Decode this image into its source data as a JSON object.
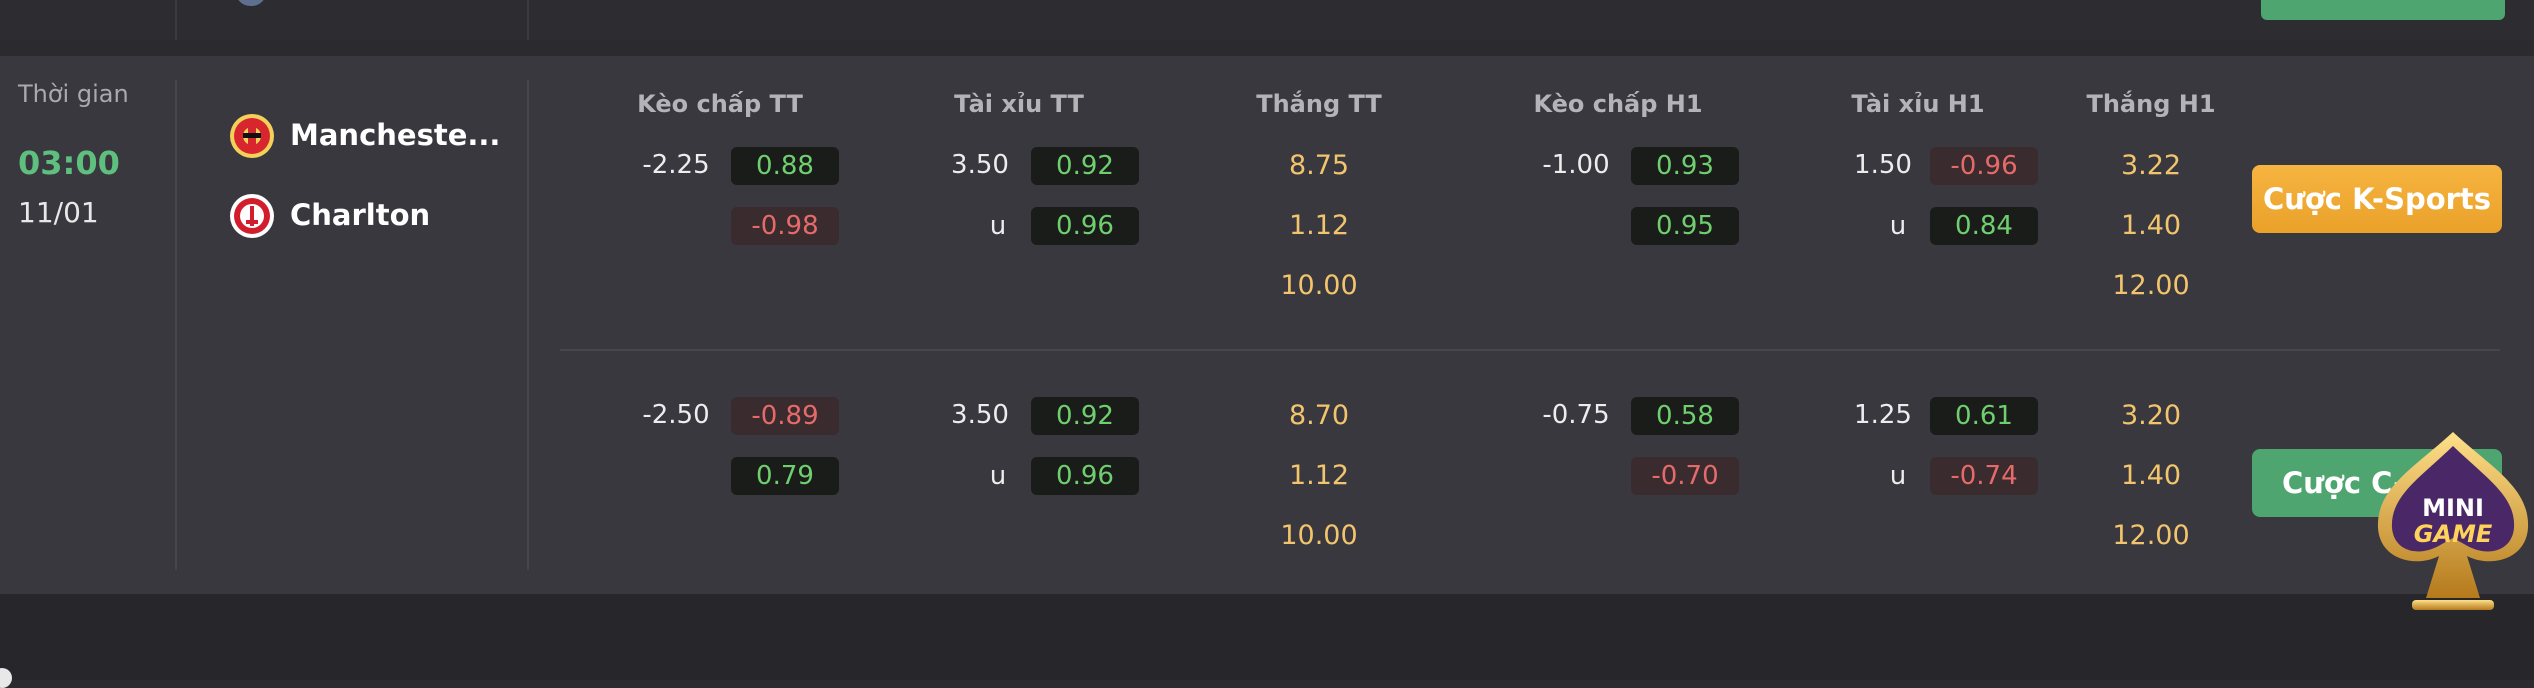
{
  "card": {
    "time_label": "Thời gian",
    "time": "03:00",
    "date": "11/01",
    "home_team": "Mancheste...",
    "away_team": "Charlton"
  },
  "headers": [
    "Kèo chấp TT",
    "Tài xỉu TT",
    "Thắng TT",
    "Kèo chấp H1",
    "Tài xỉu H1",
    "Thắng H1"
  ],
  "market1": {
    "hdp_tt_line": "-2.25",
    "hdp_tt_home": "0.88",
    "hdp_tt_away": "-0.98",
    "ou_tt_line": "3.50",
    "ou_tt_over": "0.92",
    "ou_tt_u": "u",
    "ou_tt_under": "0.96",
    "win_tt_home": "8.75",
    "win_tt_away": "1.12",
    "win_tt_draw": "10.00",
    "hdp_h1_line": "-1.00",
    "hdp_h1_home": "0.93",
    "hdp_h1_away": "0.95",
    "ou_h1_line": "1.50",
    "ou_h1_over": "-0.96",
    "ou_h1_u": "u",
    "ou_h1_under": "0.84",
    "win_h1_home": "3.22",
    "win_h1_away": "1.40",
    "win_h1_draw": "12.00",
    "button": "Cược K-Sports"
  },
  "market2": {
    "hdp_tt_line": "-2.50",
    "hdp_tt_home": "-0.89",
    "hdp_tt_away": "0.79",
    "ou_tt_line": "3.50",
    "ou_tt_over": "0.92",
    "ou_tt_u": "u",
    "ou_tt_under": "0.96",
    "win_tt_home": "8.70",
    "win_tt_away": "1.12",
    "win_tt_draw": "10.00",
    "hdp_h1_line": "-0.75",
    "hdp_h1_home": "0.58",
    "hdp_h1_away": "-0.70",
    "ou_h1_line": "1.25",
    "ou_h1_over": "0.61",
    "ou_h1_u": "u",
    "ou_h1_under": "-0.74",
    "win_h1_home": "3.20",
    "win_h1_away": "1.40",
    "win_h1_draw": "12.00",
    "button": "Cược C-S"
  },
  "badge": {
    "line1": "MINI",
    "line2": "GAME"
  },
  "colors": {
    "positive": "#6fcf6f",
    "negative": "#e66a6a",
    "gold": "#f2c46d",
    "k_button": "#f6b440",
    "c_button": "#4ea56f",
    "time": "#5fbf7e"
  },
  "icons": {
    "home_logo": "manchester-united-crest-icon",
    "away_logo": "charlton-crest-icon",
    "badge": "mini-game-spade-icon"
  }
}
